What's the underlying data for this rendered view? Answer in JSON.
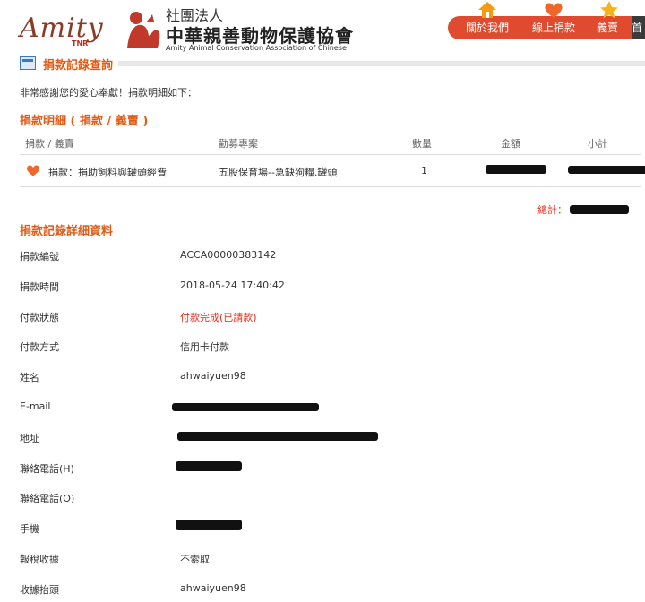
{
  "header": {
    "logo_amity": "Amity",
    "logo_tnr": "TNR",
    "logo_sub": "社團法人",
    "logo_name": "中華親善動物保護協會",
    "logo_en": "Amity Animal Conservation Association of Chinese",
    "nav": [
      {
        "label": "關於我們",
        "icon": "home-icon"
      },
      {
        "label": "線上捐款",
        "icon": "heart-icon"
      },
      {
        "label": "義賣",
        "icon": "star-icon"
      }
    ],
    "nav_partial": "首"
  },
  "page_title": "捐款記錄查詢",
  "intro": "非常感謝您的愛心奉獻！捐款明細如下：",
  "details_heading": "捐款明細 ( 捐款 / 義賣 )",
  "table": {
    "headers": [
      "捐款 / 義賣",
      "勸募專案",
      "數量",
      "金額",
      "小計"
    ],
    "rows": [
      {
        "item": "捐款：捐助飼料與罐頭經費",
        "project": "五股保育場--急缺狗糧.罐頭",
        "qty": "1"
      }
    ]
  },
  "total_label": "總計：",
  "record_heading": "捐款記錄詳細資料",
  "record": [
    {
      "label": "捐款編號",
      "value": "ACCA00000383142"
    },
    {
      "label": "捐款時間",
      "value": "2018-05-24 17:40:42"
    },
    {
      "label": "付款狀態",
      "value": "付款完成(已請款)"
    },
    {
      "label": "付款方式",
      "value": "信用卡付款"
    },
    {
      "label": "姓名",
      "value": "ahwaiyuen98"
    },
    {
      "label": "E-mail",
      "value": ""
    },
    {
      "label": "地址",
      "value": ""
    },
    {
      "label": "聯絡電話(H)",
      "value": ""
    },
    {
      "label": "聯絡電話(O)",
      "value": ""
    },
    {
      "label": "手機",
      "value": ""
    },
    {
      "label": "報稅收據",
      "value": "不索取"
    },
    {
      "label": "收據抬頭",
      "value": "ahwaiyuen98"
    }
  ],
  "colors": {
    "accent": "#e05b16",
    "nav": "#e04a2e",
    "alert": "#e03020"
  }
}
